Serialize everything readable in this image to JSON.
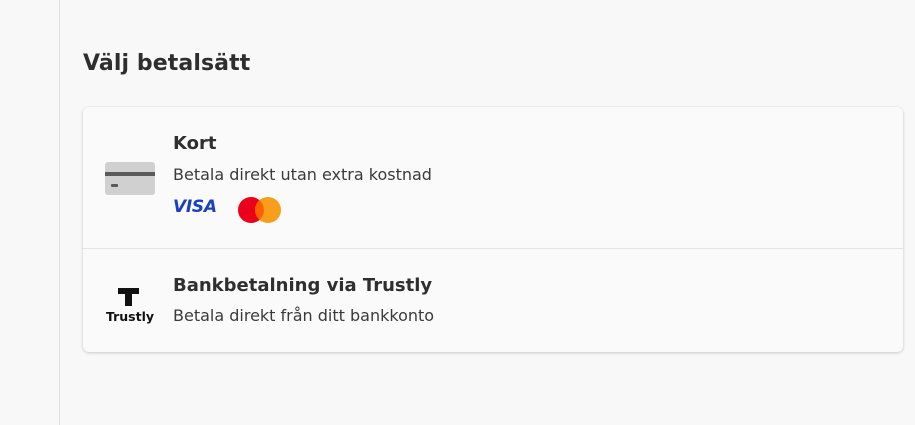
{
  "page": {
    "title": "Välj betalsätt"
  },
  "payment_options": [
    {
      "id": "card",
      "title": "Kort",
      "subtitle": "Betala direkt utan extra kostnad",
      "icon": "credit-card-icon",
      "brands": [
        "visa-logo",
        "mastercard-logo"
      ]
    },
    {
      "id": "trustly",
      "title": "Bankbetalning via Trustly",
      "subtitle": "Betala direkt från ditt bankkonto",
      "icon": "trustly-logo"
    }
  ],
  "logos": {
    "visa": "VISA",
    "trustly": "Trustly"
  },
  "colors": {
    "background": "#f8f8f8",
    "visa_blue": "#1a3fbf",
    "mastercard_red": "#eb001b",
    "mastercard_orange": "#f79e1b",
    "card_icon_gray": "#d0d0d0",
    "card_icon_stripe": "#5a5a5a"
  }
}
